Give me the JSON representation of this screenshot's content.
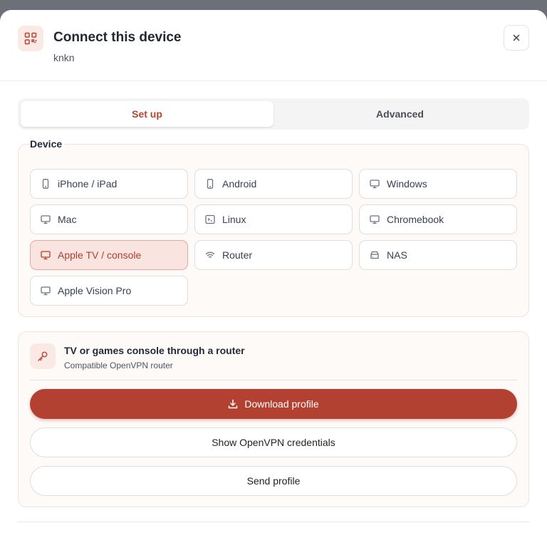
{
  "header": {
    "title": "Connect this device",
    "subtitle": "knkn",
    "icon": "qr-code-icon",
    "close_icon": "close-icon"
  },
  "tabs": [
    {
      "label": "Set up",
      "active": true
    },
    {
      "label": "Advanced",
      "active": false
    }
  ],
  "device_section": {
    "legend": "Device",
    "items": [
      {
        "label": "iPhone / iPad",
        "icon": "phone-icon",
        "selected": false
      },
      {
        "label": "Android",
        "icon": "phone-icon",
        "selected": false
      },
      {
        "label": "Windows",
        "icon": "monitor-icon",
        "selected": false
      },
      {
        "label": "Mac",
        "icon": "monitor-icon",
        "selected": false
      },
      {
        "label": "Linux",
        "icon": "terminal-icon",
        "selected": false
      },
      {
        "label": "Chromebook",
        "icon": "monitor-icon",
        "selected": false
      },
      {
        "label": "Apple TV / console",
        "icon": "monitor-icon",
        "selected": true
      },
      {
        "label": "Router",
        "icon": "wifi-icon",
        "selected": false
      },
      {
        "label": "NAS",
        "icon": "storage-icon",
        "selected": false
      },
      {
        "label": "Apple Vision Pro",
        "icon": "monitor-icon",
        "selected": false
      }
    ]
  },
  "router_section": {
    "title": "TV or games console through a router",
    "subtitle": "Compatible OpenVPN router",
    "icon": "key-icon",
    "download_label": "Download profile",
    "credentials_label": "Show OpenVPN credentials",
    "send_label": "Send profile"
  },
  "colors": {
    "accent": "#b34132",
    "accent_soft": "#f9e4e0",
    "backdrop": "#6e7079"
  }
}
